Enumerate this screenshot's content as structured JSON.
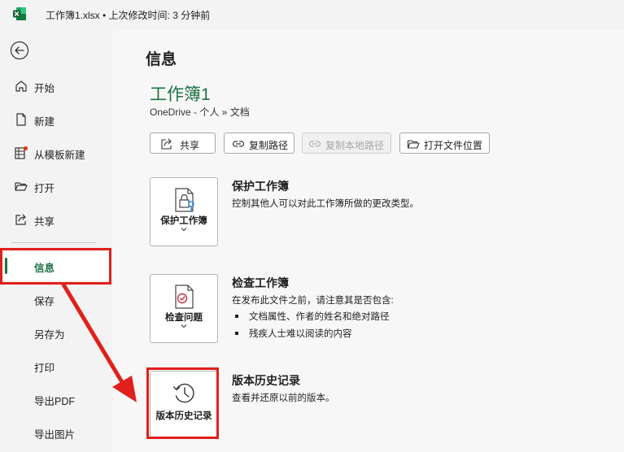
{
  "titlebar": {
    "title": "工作簿1.xlsx • 上次修改时间: 3 分钟前"
  },
  "sidebar": {
    "back_label": "返回",
    "items": [
      {
        "label": "开始",
        "icon": "home-icon"
      },
      {
        "label": "新建",
        "icon": "new-doc-icon"
      },
      {
        "label": "从模板新建",
        "icon": "template-icon"
      },
      {
        "label": "打开",
        "icon": "folder-open-icon"
      },
      {
        "label": "共享",
        "icon": "share-icon"
      },
      {
        "label": "信息",
        "selected": true
      },
      {
        "label": "保存"
      },
      {
        "label": "另存为"
      },
      {
        "label": "打印"
      },
      {
        "label": "导出PDF"
      },
      {
        "label": "导出图片"
      }
    ]
  },
  "main": {
    "page_title": "信息",
    "doc_title": "工作簿1",
    "doc_path": "OneDrive - 个人 » 文档",
    "toolbar": [
      {
        "label": "共享",
        "icon": "share-icon",
        "enabled": true
      },
      {
        "label": "复制路径",
        "icon": "link-icon",
        "enabled": true
      },
      {
        "label": "复制本地路径",
        "icon": "link-icon",
        "enabled": false
      },
      {
        "label": "打开文件位置",
        "icon": "folder-open-icon",
        "enabled": true
      }
    ],
    "sections": {
      "protect": {
        "tile_label": "保护工作簿",
        "title": "保护工作簿",
        "desc": "控制其他人可以对此工作簿所做的更改类型。"
      },
      "inspect": {
        "tile_label": "检查问题",
        "title": "检查工作簿",
        "desc": "在发布此文件之前，请注意其是否包含:",
        "bullets": [
          "文档属性、作者的姓名和绝对路径",
          "残疾人士难以阅读的内容"
        ]
      },
      "history": {
        "tile_label": "版本历史记录",
        "title": "版本历史记录",
        "desc": "查看并还原以前的版本。"
      }
    }
  },
  "colors": {
    "accent_green": "#1e7145",
    "annotation_red": "#e0201b"
  }
}
